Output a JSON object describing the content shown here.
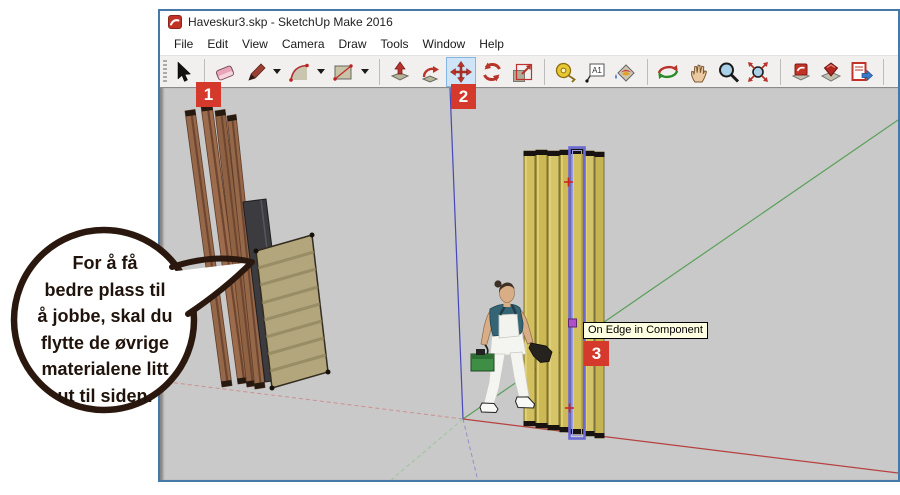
{
  "window": {
    "title": "Haveskur3.skp - SketchUp Make 2016"
  },
  "menu": {
    "items": [
      "File",
      "Edit",
      "View",
      "Camera",
      "Draw",
      "Tools",
      "Window",
      "Help"
    ]
  },
  "toolbar": {
    "active_tool": "move",
    "text_icon_label": "A1",
    "tools": [
      "select",
      "eraser",
      "line",
      "arc",
      "rectangle",
      "push-pull",
      "follow-me",
      "move",
      "rotate",
      "scale",
      "tape-measure",
      "text",
      "paint-bucket",
      "orbit",
      "pan",
      "zoom",
      "zoom-extents",
      "get-models",
      "share-model",
      "send-to-layout"
    ]
  },
  "scene": {
    "tooltip": "On Edge in Component",
    "axis_colors": {
      "red": "#b84040",
      "green": "#5aa05a",
      "blue": "#4747b8"
    },
    "selection_color": "#6a6ad6",
    "materials": {
      "plank_brown": "#96684a",
      "panel_dark": "#3b3b40",
      "plywood_tan": "#b3a67c",
      "stud_yellow": "#d2bf5e"
    }
  },
  "callouts": {
    "labels": [
      "1",
      "2",
      "3"
    ],
    "color": "#d4392b",
    "bubble_text": "For å få\nbedre plass til\nå jobbe, skal du\nflytte de øvrige\nmaterialene litt\nut til siden."
  }
}
